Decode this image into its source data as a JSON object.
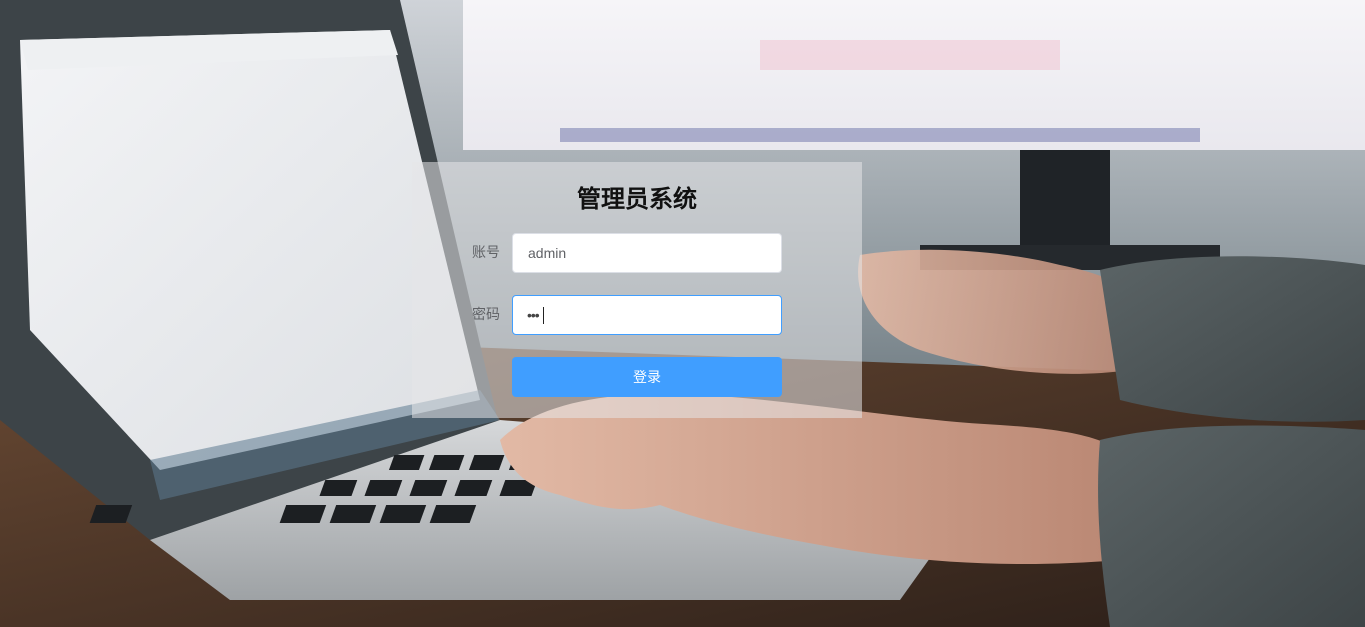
{
  "login": {
    "title": "管理员系统",
    "account_label": "账号",
    "account_value": "admin",
    "password_label": "密码",
    "password_masked": "•••",
    "submit_label": "登录"
  },
  "colors": {
    "primary": "#409eff",
    "panel_bg": "rgba(230,230,232,0.55)",
    "label_text": "#606266"
  }
}
